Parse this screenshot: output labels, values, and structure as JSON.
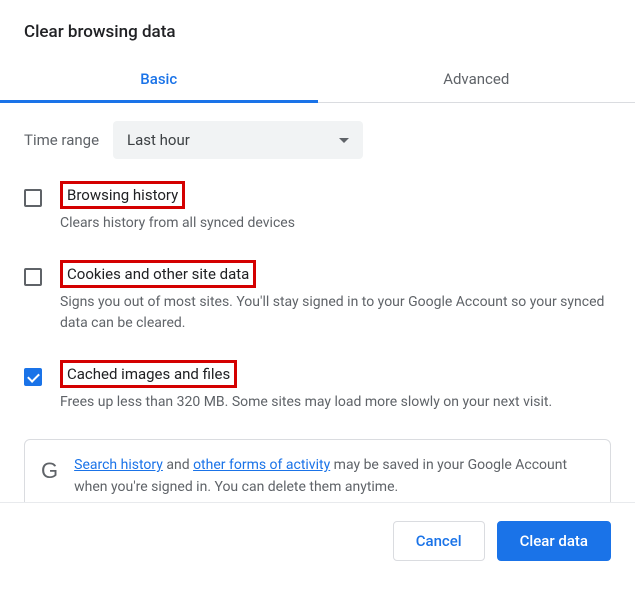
{
  "title": "Clear browsing data",
  "tabs": {
    "basic": "Basic",
    "advanced": "Advanced"
  },
  "time": {
    "label": "Time range",
    "value": "Last hour"
  },
  "options": [
    {
      "title": "Browsing history",
      "desc": "Clears history from all synced devices",
      "checked": false
    },
    {
      "title": "Cookies and other site data",
      "desc": "Signs you out of most sites. You'll stay signed in to your Google Account so your synced data can be cleared.",
      "checked": false
    },
    {
      "title": "Cached images and files",
      "desc": "Frees up less than 320 MB. Some sites may load more slowly on your next visit.",
      "checked": true
    }
  ],
  "info": {
    "link1": "Search history",
    "mid1": " and ",
    "link2": "other forms of activity",
    "rest": " may be saved in your Google Account when you're signed in. You can delete them anytime."
  },
  "buttons": {
    "cancel": "Cancel",
    "clear": "Clear data"
  }
}
